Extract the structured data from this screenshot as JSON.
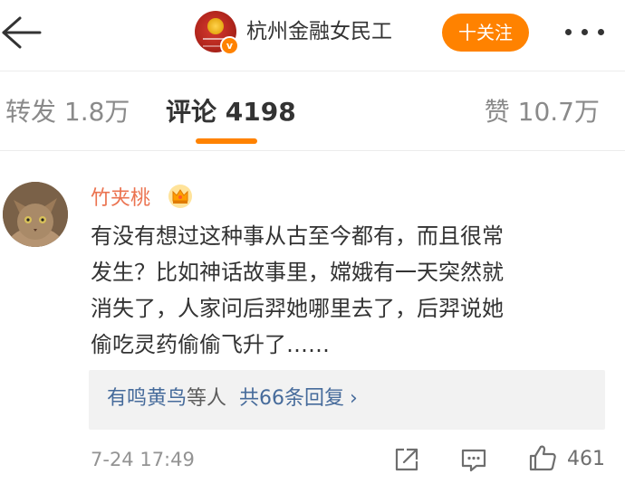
{
  "header": {
    "account_name": "杭州金融女民工",
    "follow_label": "十关注",
    "verified_badge": "v"
  },
  "tabs": {
    "repost": "转发 1.8万",
    "comments": "评论 4198",
    "likes": "赞 10.7万"
  },
  "comment": {
    "username": "竹夹桃",
    "lines": [
      "有没有想过这种事从古至今都有，而且很常",
      "发生？比如神话故事里，嫦娥有一天突然就",
      "消失了，人家问后羿她哪里去了，后羿说她",
      "偷吃灵药偷偷飞升了……"
    ],
    "reply_summary": {
      "users": "有鸣黄鸟",
      "connector": "等人",
      "count_label": "共66条回复",
      "chevron": "›"
    },
    "time": "7-24 17:49",
    "like_count": "461"
  },
  "colors": {
    "accent": "#ff8200",
    "username": "#eb7350",
    "link_blue": "#466b9b"
  },
  "icons": [
    "back-arrow-icon",
    "more-dots-icon",
    "crown-icon",
    "share-icon",
    "reply-icon",
    "thumbs-up-icon"
  ]
}
